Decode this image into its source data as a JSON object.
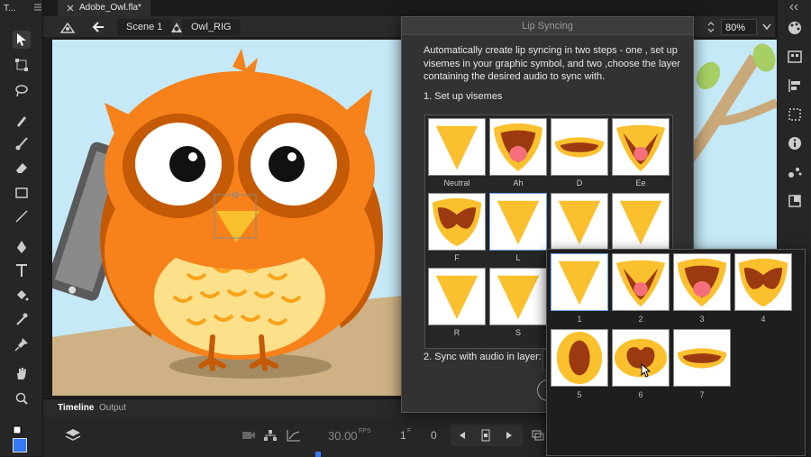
{
  "window": {
    "tab_title": "Adobe_Owl.fla*",
    "short_title": "T..."
  },
  "editbar": {
    "scene": "Scene 1",
    "symbol": "Owl_RIG",
    "zoom": "80%"
  },
  "dialog": {
    "title": "Lip Syncing",
    "description": "Automatically create lip syncing in two steps - one , set up visemes in your graphic symbol, and two ,choose the layer containing the desired audio to sync with.",
    "step1": "1. Set up visemes",
    "step2": "2. Sync with audio in layer:",
    "visemes": [
      {
        "label": "Neutral",
        "shape": "neutral"
      },
      {
        "label": "Ah",
        "shape": "ah"
      },
      {
        "label": "D",
        "shape": "d"
      },
      {
        "label": "Ee",
        "shape": "ee"
      },
      {
        "label": "F",
        "shape": "f"
      },
      {
        "label": "L",
        "shape": "neutral"
      },
      {
        "label": "",
        "shape": "neutral"
      },
      {
        "label": "",
        "shape": "neutral"
      },
      {
        "label": "R",
        "shape": "neutral"
      },
      {
        "label": "S",
        "shape": "neutral"
      }
    ]
  },
  "picker": {
    "frames": [
      {
        "label": "1",
        "shape": "neutral"
      },
      {
        "label": "2",
        "shape": "ee"
      },
      {
        "label": "3",
        "shape": "ah"
      },
      {
        "label": "4",
        "shape": "f"
      },
      {
        "label": "5",
        "shape": "o"
      },
      {
        "label": "6",
        "shape": "u"
      },
      {
        "label": "7",
        "shape": "d"
      }
    ]
  },
  "timeline": {
    "tabs": [
      "Timeline",
      "Output"
    ],
    "fps": "30.00",
    "fps_unit": "FPS",
    "frame": "1",
    "frame_suffix": "F",
    "counter": "0"
  },
  "colors": {
    "owl_orange": "#f7811a",
    "owl_dark": "#c45a06",
    "beak_yellow": "#fbc02d",
    "belly": "#fde08a",
    "mouth_dark": "#9b3a10",
    "tongue": "#f5707a",
    "sky": "#c5e9f7",
    "accent": "#3478f6"
  }
}
